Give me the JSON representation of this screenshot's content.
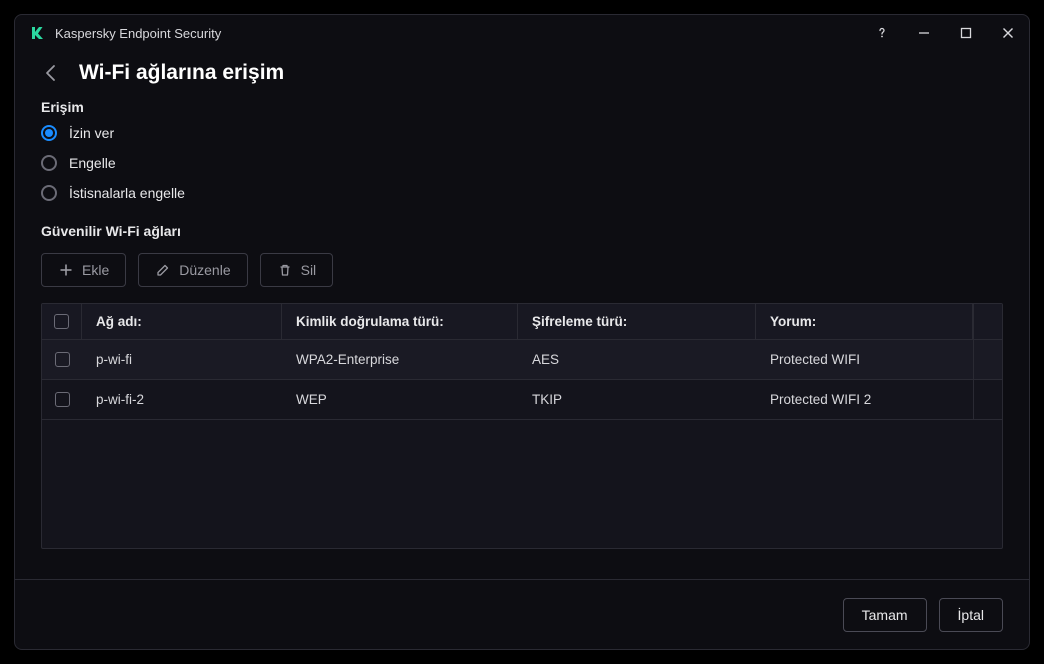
{
  "titlebar": {
    "app_name": "Kaspersky Endpoint Security"
  },
  "page": {
    "title": "Wi-Fi ağlarına erişim"
  },
  "access": {
    "label": "Erişim",
    "options": {
      "allow": "İzin ver",
      "block": "Engelle",
      "block_exceptions": "İstisnalarla engelle"
    },
    "selected": "allow"
  },
  "trusted": {
    "label": "Güvenilir Wi-Fi ağları",
    "toolbar": {
      "add": "Ekle",
      "edit": "Düzenle",
      "delete": "Sil"
    },
    "columns": {
      "name": "Ağ adı:",
      "auth": "Kimlik doğrulama türü:",
      "enc": "Şifreleme türü:",
      "comment": "Yorum:"
    },
    "rows": [
      {
        "name": "p-wi-fi",
        "auth": "WPA2-Enterprise",
        "enc": "AES",
        "comment": "Protected WIFI"
      },
      {
        "name": "p-wi-fi-2",
        "auth": "WEP",
        "enc": "TKIP",
        "comment": "Protected WIFI 2"
      }
    ]
  },
  "footer": {
    "ok": "Tamam",
    "cancel": "İptal"
  }
}
